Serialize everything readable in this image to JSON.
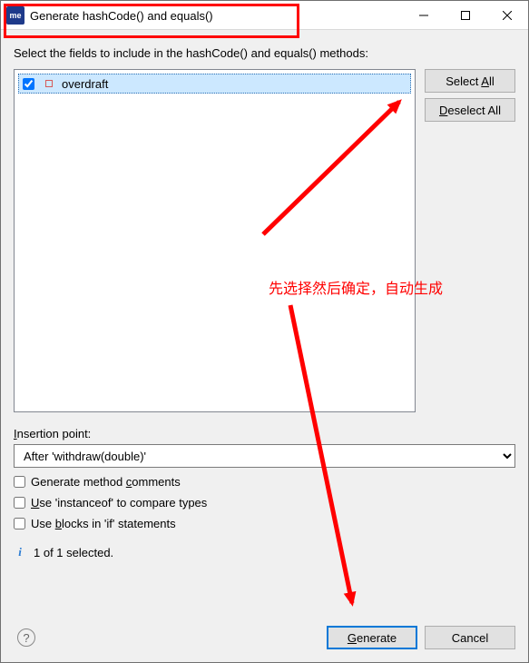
{
  "title": "Generate hashCode() and equals()",
  "icon_text": "me",
  "instruction": "Select the fields to include in the hashCode() and equals() methods:",
  "fields": {
    "items": [
      {
        "label": "overdraft",
        "checked": true
      }
    ]
  },
  "buttons": {
    "select_all_pre": "Select ",
    "select_all_u": "A",
    "select_all_post": "ll",
    "deselect_all_pre": "",
    "deselect_all_u": "D",
    "deselect_all_post": "eselect All",
    "generate_pre": "",
    "generate_u": "G",
    "generate_post": "enerate",
    "cancel": "Cancel"
  },
  "insertion": {
    "label": "Insertion point:",
    "label_pre": "",
    "label_u": "I",
    "label_post": "nsertion point:",
    "value": "After 'withdraw(double)'"
  },
  "options": {
    "comments_pre": "Generate method ",
    "comments_u": "c",
    "comments_post": "omments",
    "instanceof_pre": "",
    "instanceof_u": "U",
    "instanceof_post": "se 'instanceof' to compare types",
    "blocks_pre": "Use ",
    "blocks_u": "b",
    "blocks_post": "locks in 'if' statements"
  },
  "status": "1 of 1 selected.",
  "annotation": "先选择然后确定，自动生成"
}
